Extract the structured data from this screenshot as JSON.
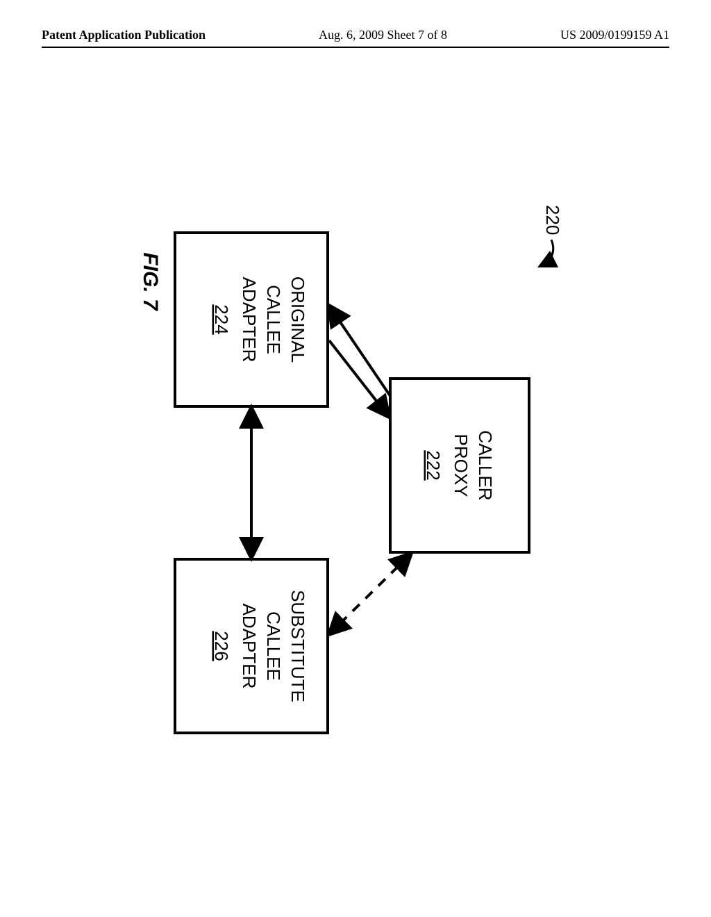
{
  "header": {
    "left": "Patent Application Publication",
    "mid": "Aug. 6, 2009  Sheet 7 of 8",
    "right": "US 2009/0199159 A1"
  },
  "diagram": {
    "id": "220",
    "figure_label": "FIG. 7",
    "boxes": {
      "caller_proxy": {
        "line1": "CALLER",
        "line2": "PROXY",
        "num": "222"
      },
      "original": {
        "line1": "ORIGINAL",
        "line2": "CALLEE",
        "line3": "ADAPTER",
        "num": "224"
      },
      "substitute": {
        "line1": "SUBSTITUTE",
        "line2": "CALLEE",
        "line3": "ADAPTER",
        "num": "226"
      }
    }
  }
}
